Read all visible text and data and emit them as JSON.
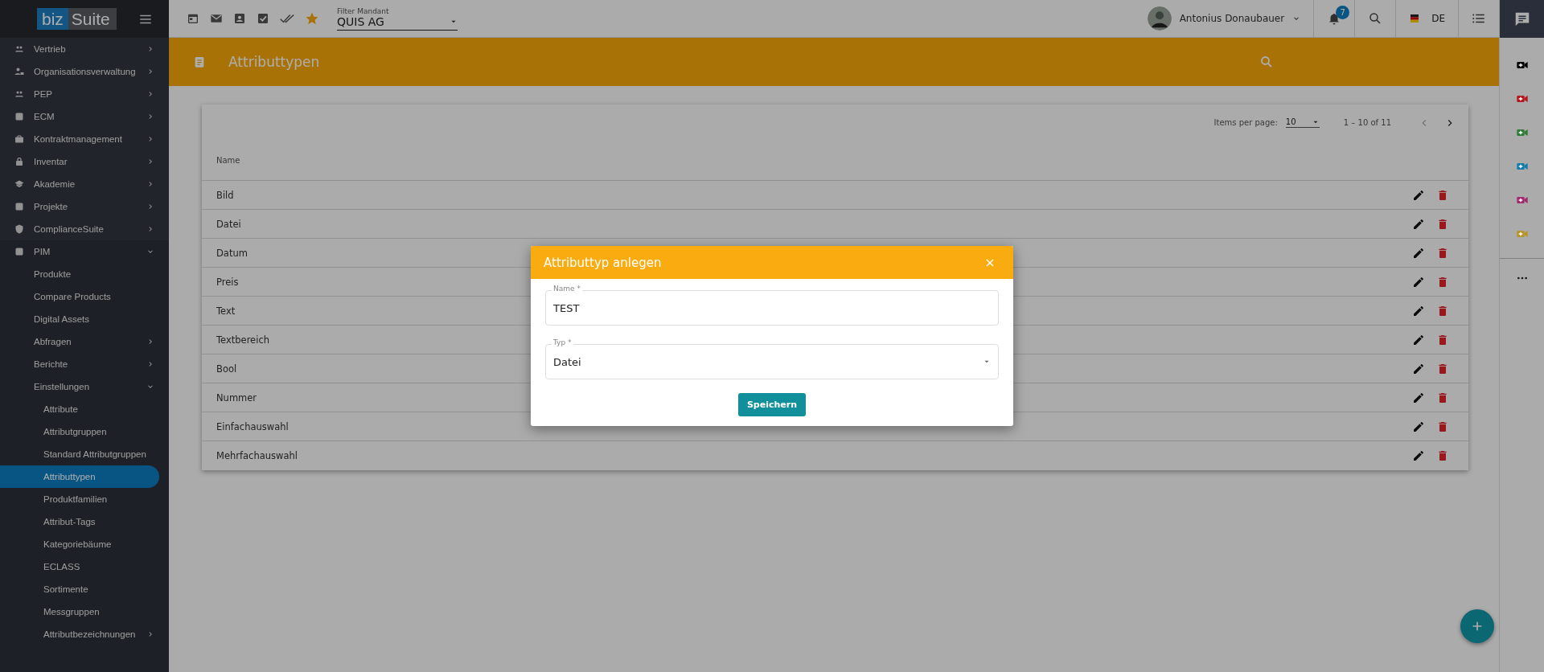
{
  "sidebar": {
    "logo": {
      "left": "biz",
      "right": "Suite"
    },
    "items": [
      {
        "label": "Vertrieb",
        "expanded": false,
        "selected": false
      },
      {
        "label": "Organisationsverwaltung",
        "expanded": false,
        "selected": false
      },
      {
        "label": "PEP",
        "expanded": false,
        "selected": false
      },
      {
        "label": "ECM",
        "expanded": false,
        "selected": false
      },
      {
        "label": "Kontraktmanagement",
        "expanded": false,
        "selected": false
      },
      {
        "label": "Inventar",
        "expanded": false,
        "selected": false
      },
      {
        "label": "Akademie",
        "expanded": false,
        "selected": false
      },
      {
        "label": "Projekte",
        "expanded": false,
        "selected": false
      },
      {
        "label": "ComplianceSuite",
        "expanded": false,
        "selected": false
      },
      {
        "label": "PIM",
        "expanded": true,
        "selected": false,
        "children": [
          {
            "label": "Produkte",
            "selected": false
          },
          {
            "label": "Compare Products",
            "selected": false
          },
          {
            "label": "Digital Assets",
            "selected": false
          },
          {
            "label": "Abfragen",
            "expanded": false,
            "selected": false
          },
          {
            "label": "Berichte",
            "expanded": false,
            "selected": false
          },
          {
            "label": "Einstellungen",
            "expanded": true,
            "selected": false,
            "children": [
              {
                "label": "Attribute",
                "selected": false
              },
              {
                "label": "Attributgruppen",
                "selected": false
              },
              {
                "label": "Standard Attributgruppen",
                "selected": false
              },
              {
                "label": "Attributtypen",
                "selected": true
              },
              {
                "label": "Produktfamilien",
                "selected": false
              },
              {
                "label": "Attribut-Tags",
                "selected": false
              },
              {
                "label": "Kategoriebäume",
                "selected": false
              },
              {
                "label": "ECLASS",
                "selected": false
              },
              {
                "label": "Sortimente",
                "selected": false
              },
              {
                "label": "Messgruppen",
                "selected": false
              },
              {
                "label": "Attributbezeichnungen",
                "expanded": false,
                "selected": false
              }
            ]
          }
        ]
      }
    ]
  },
  "topbar": {
    "filter": {
      "label": "Filter Mandant",
      "value": "QUIS AG"
    },
    "user": {
      "name": "Antonius Donaubauer"
    },
    "notifications": {
      "count": "7"
    },
    "language": {
      "code": "DE"
    }
  },
  "page_header": {
    "title": "Attributtypen"
  },
  "table": {
    "paginator": {
      "items_per_page_label": "Items per page:",
      "page_size": "10",
      "range": "1 – 10 of 11",
      "previous_disabled": true,
      "next_disabled": false
    },
    "columns": [
      "Name"
    ],
    "rows": [
      {
        "name": "Bild"
      },
      {
        "name": "Datei"
      },
      {
        "name": "Datum"
      },
      {
        "name": "Preis"
      },
      {
        "name": "Text"
      },
      {
        "name": "Textbereich"
      },
      {
        "name": "Bool"
      },
      {
        "name": "Nummer"
      },
      {
        "name": "Einfachauswahl"
      },
      {
        "name": "Mehrfachauswahl"
      }
    ]
  },
  "right_rail": {
    "items": [
      {
        "color": "#000000"
      },
      {
        "color": "#b3161c"
      },
      {
        "color": "#2f7a37"
      },
      {
        "color": "#127ba8"
      },
      {
        "color": "#a02a6c"
      },
      {
        "color": "#b4952a"
      }
    ]
  },
  "dialog": {
    "title": "Attributtyp anlegen",
    "fields": [
      {
        "kind": "text",
        "label": "Name *",
        "value": "TEST"
      },
      {
        "kind": "select",
        "label": "Typ *",
        "value": "Datei"
      }
    ],
    "button": "Speichern"
  }
}
